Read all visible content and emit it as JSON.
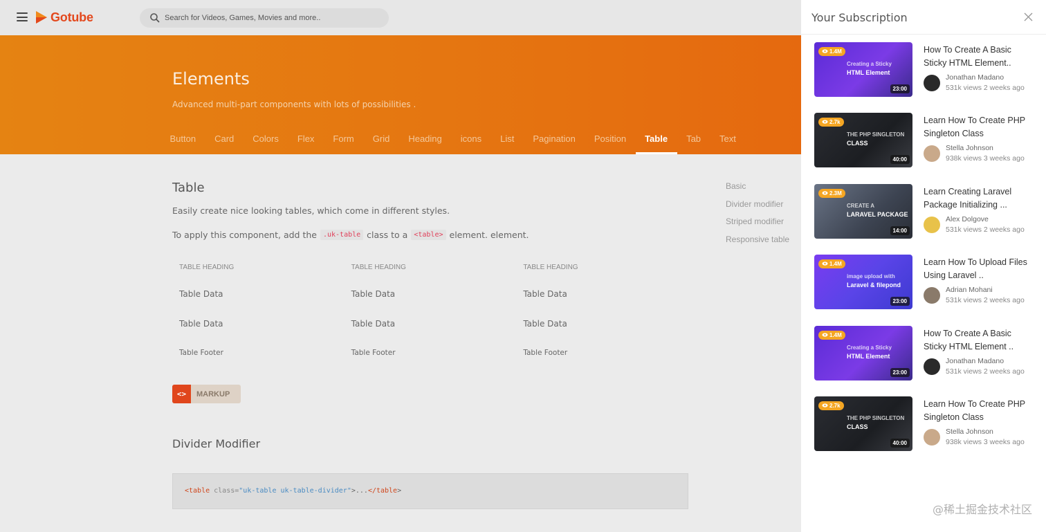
{
  "app": {
    "brand": "Gotube",
    "brand_color": "#e3481d",
    "accent": "#e57611"
  },
  "search": {
    "placeholder": "Search for Videos, Games, Movies and more.."
  },
  "hero": {
    "title": "Elements",
    "subtitle": "Advanced multi-part components with lots of possibilities .",
    "tabs": [
      "Button",
      "Card",
      "Colors",
      "Flex",
      "Form",
      "Grid",
      "Heading",
      "icons",
      "List",
      "Pagination",
      "Position",
      "Table",
      "Tab",
      "Text"
    ],
    "active_tab": "Table"
  },
  "content": {
    "title": "Table",
    "intro": "Easily create nice looking tables, which come in different styles.",
    "apply_prefix": "To apply this component, add the",
    "apply_code1": ".uk-table",
    "apply_middle": "class to a",
    "apply_code2": "<table>",
    "apply_suffix": "element. element.",
    "table": {
      "headers": [
        "TABLE HEADING",
        "TABLE HEADING",
        "TABLE HEADING"
      ],
      "rows": [
        [
          "Table Data",
          "Table Data",
          "Table Data"
        ],
        [
          "Table Data",
          "Table Data",
          "Table Data"
        ]
      ],
      "footer": [
        "Table Footer",
        "Table Footer",
        "Table Footer"
      ]
    },
    "markup_icon": "<>",
    "markup_label": "MARKUP",
    "section2_title": "Divider Modifier",
    "code": {
      "tag_open": "<table",
      "attr": " class=",
      "value": "\"uk-table uk-table-divider\"",
      "mid": ">...",
      "tag_close": "</table",
      "end": ">"
    }
  },
  "toc": [
    "Basic",
    "Divider modifier",
    "Striped modifier",
    "Responsive table"
  ],
  "panel": {
    "title": "Your Subscription",
    "videos": [
      {
        "views": "1.4M",
        "duration": "23:00",
        "thumb_line1": "Creating a Sticky",
        "thumb_line2": "HTML Element",
        "thumb_theme": "purple",
        "title": "How To Create A Basic Sticky HTML Element..",
        "author": "Jonathan Madano",
        "meta": "531k views 2 weeks ago"
      },
      {
        "views": "2.7k",
        "duration": "40:00",
        "thumb_line1": "THE PHP SINGLETON",
        "thumb_line2": "CLASS",
        "thumb_theme": "dark",
        "title": "Learn How To Create PHP Singleton Class",
        "author": "Stella Johnson",
        "meta": "938k views 3 weeks ago"
      },
      {
        "views": "2.3M",
        "duration": "14:00",
        "thumb_line1": "CREATE A",
        "thumb_line2": "LARAVEL PACKAGE",
        "thumb_theme": "gray",
        "title": "Learn Creating Laravel Package Initializing ...",
        "author": "Alex Dolgove",
        "meta": "531k views 2 weeks ago"
      },
      {
        "views": "1.4M",
        "duration": "23:00",
        "thumb_line1": "image upload with",
        "thumb_line2": "Laravel & filepond",
        "thumb_theme": "violet",
        "title": "Learn How To Upload Files Using Laravel ..",
        "author": "Adrian Mohani",
        "meta": "531k views 2 weeks ago"
      },
      {
        "views": "1.4M",
        "duration": "23:00",
        "thumb_line1": "Creating a Sticky",
        "thumb_line2": "HTML Element",
        "thumb_theme": "purple",
        "title": "How To Create A Basic Sticky HTML Element ..",
        "author": "Jonathan Madano",
        "meta": "531k views 2 weeks ago"
      },
      {
        "views": "2.7k",
        "duration": "40:00",
        "thumb_line1": "THE PHP SINGLETON",
        "thumb_line2": "CLASS",
        "thumb_theme": "dark",
        "title": "Learn How To Create PHP Singleton Class",
        "author": "Stella Johnson",
        "meta": "938k views 3 weeks ago"
      }
    ]
  },
  "watermark": "@稀土掘金技术社区"
}
